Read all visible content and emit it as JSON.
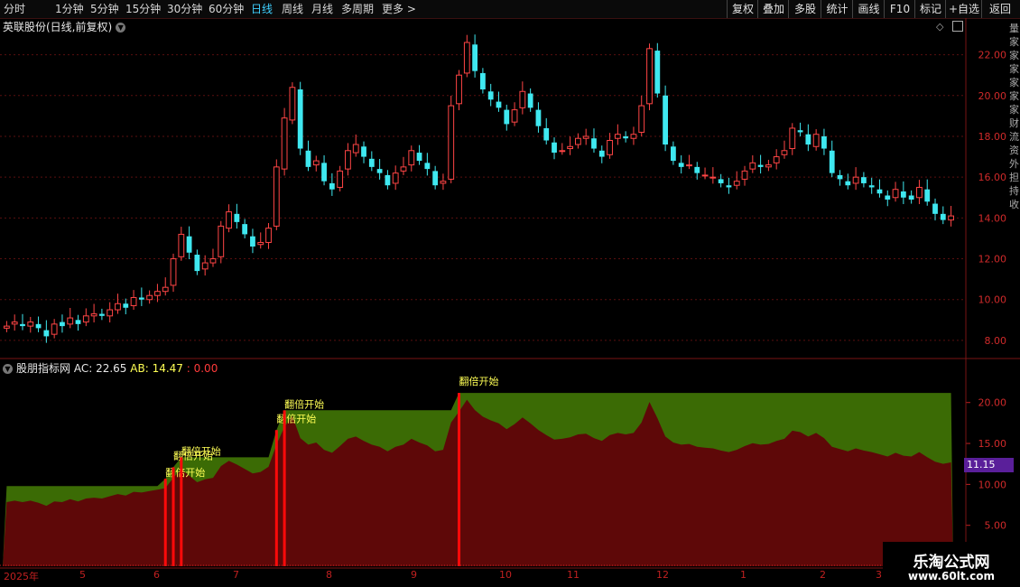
{
  "toolbar": {
    "periods": [
      "分时",
      "1分钟",
      "5分钟",
      "15分钟",
      "30分钟",
      "60分钟",
      "日线",
      "周线",
      "月线",
      "多周期",
      "更多 >"
    ],
    "active_period": "日线",
    "right_buttons": [
      "复权",
      "叠加",
      "多股",
      "统计",
      "画线",
      "F10",
      "标记",
      "+自选",
      "返回"
    ]
  },
  "chart": {
    "title": "英联股份(日线,前复权)",
    "price_ticks": [
      "22.00",
      "20.00",
      "18.00",
      "16.00",
      "14.00",
      "12.00",
      "10.00",
      "8.00"
    ],
    "colors": {
      "up": "#ff4545",
      "down": "#3fe8f0",
      "grid": "#5a0f0f",
      "border": "#7a1515"
    }
  },
  "indicator": {
    "name": "股朋指标网",
    "ac_label": "AC: 22.65",
    "ab_label": "AB: 14.47",
    "zero_label": ": 0.00",
    "ticks": [
      "20.00",
      "15.00",
      "10.00",
      "5.00"
    ],
    "signal_label": "翻倍开始",
    "colors": {
      "green": "#3b6b05",
      "red": "#5e0808",
      "signal": "#ff0a0a"
    }
  },
  "price_tag": "11.15",
  "date_axis": [
    "2025年",
    "5",
    "6",
    "7",
    "8",
    "9",
    "10",
    "11",
    "12",
    "1",
    "2",
    "3"
  ],
  "watermark": {
    "line1": "乐淘公式网",
    "line2": "www.60lt.com"
  },
  "right_edge_glyphs": "量家家家家家家财流资外担持收",
  "chart_data": {
    "type": "candlestick",
    "title": "英联股份(日线,前复权)",
    "series": [
      {
        "name": "close",
        "values": [
          8.7,
          8.9,
          8.7,
          8.9,
          8.6,
          8.2,
          8.8,
          8.7,
          9.1,
          8.8,
          9.2,
          9.3,
          9.2,
          9.5,
          9.8,
          9.6,
          10.1,
          10.0,
          10.2,
          10.4,
          10.6,
          12.0,
          13.2,
          12.3,
          11.4,
          11.8,
          12.0,
          13.6,
          14.3,
          13.8,
          13.2,
          12.6,
          12.8,
          13.5,
          16.5,
          18.9,
          20.4,
          17.4,
          16.5,
          16.8,
          15.8,
          15.4,
          16.3,
          17.3,
          17.6,
          17.0,
          16.5,
          16.2,
          15.6,
          16.2,
          16.5,
          17.3,
          16.8,
          16.4,
          15.6,
          15.8,
          19.5,
          21.0,
          22.6,
          21.2,
          20.3,
          19.8,
          19.4,
          18.6,
          19.3,
          20.2,
          19.4,
          18.5,
          17.8,
          17.2,
          17.3,
          17.5,
          17.9,
          18.0,
          17.4,
          17.0,
          17.8,
          18.1,
          17.9,
          18.1,
          19.5,
          22.3,
          20.1,
          17.6,
          16.8,
          16.5,
          16.6,
          16.2,
          16.1,
          16.0,
          15.7,
          15.5,
          15.8,
          16.3,
          16.7,
          16.5,
          16.6,
          17.0,
          17.3,
          18.4,
          18.2,
          17.6,
          18.1,
          17.4,
          16.2,
          15.9,
          15.6,
          16.0,
          15.7,
          15.5,
          15.2,
          14.9,
          15.4,
          15.0,
          14.9,
          15.5,
          14.8,
          14.2,
          13.9,
          14.1
        ]
      },
      {
        "name": "open",
        "values": [
          8.6,
          8.8,
          8.8,
          8.7,
          8.8,
          8.5,
          8.3,
          8.9,
          8.8,
          9.0,
          8.9,
          9.2,
          9.3,
          9.2,
          9.5,
          9.8,
          9.7,
          10.1,
          10.0,
          10.2,
          10.4,
          10.7,
          12.1,
          13.1,
          12.2,
          11.5,
          11.8,
          12.1,
          13.5,
          14.2,
          13.7,
          13.1,
          12.7,
          12.8,
          13.6,
          16.4,
          18.8,
          20.3,
          17.3,
          16.6,
          16.7,
          15.7,
          15.5,
          16.4,
          17.2,
          17.5,
          16.9,
          16.4,
          16.1,
          15.7,
          16.3,
          16.6,
          17.2,
          16.7,
          16.3,
          15.7,
          15.9,
          19.6,
          21.1,
          22.5,
          21.1,
          20.2,
          19.7,
          19.3,
          18.7,
          19.4,
          20.1,
          19.3,
          18.4,
          17.7,
          17.3,
          17.4,
          17.6,
          17.9,
          17.9,
          17.3,
          17.1,
          17.9,
          18.0,
          17.9,
          18.2,
          19.6,
          22.2,
          20.0,
          17.5,
          16.7,
          16.6,
          16.5,
          16.1,
          16.0,
          15.9,
          15.6,
          15.6,
          15.9,
          16.4,
          16.6,
          16.5,
          16.7,
          17.1,
          17.4,
          18.3,
          18.1,
          17.5,
          18.0,
          17.3,
          16.1,
          15.8,
          15.7,
          16.0,
          15.6,
          15.4,
          15.1,
          15.0,
          15.3,
          15.1,
          15.0,
          15.4,
          14.7,
          14.2,
          13.9
        ]
      }
    ],
    "ylim": [
      7.2,
      23.0
    ],
    "indicator": {
      "name": "股朋指标网",
      "AC": 22.65,
      "AB": 14.47,
      "ticks": [
        20,
        15,
        10,
        5
      ],
      "signal_label": "翻倍开始"
    }
  }
}
